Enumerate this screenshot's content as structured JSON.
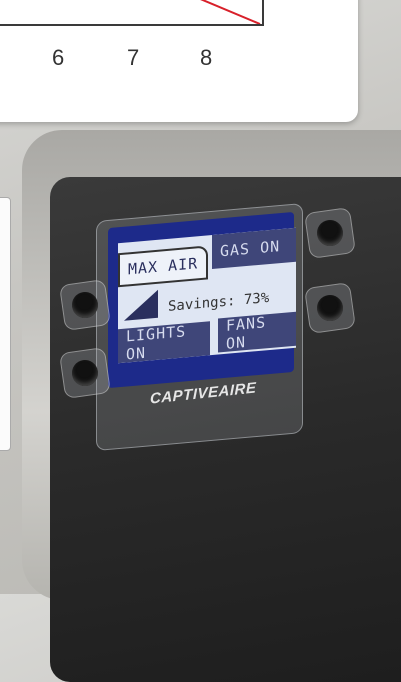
{
  "chart": {
    "ticks": [
      "6",
      "7",
      "8"
    ]
  },
  "display": {
    "brand": "CAPTIVEAIRE",
    "softkeys": {
      "max_air": "MAX AIR",
      "gas_on": "GAS ON",
      "lights_on": "LIGHTS ON",
      "fans_on": "FANS ON"
    },
    "savings": "Savings: 73%"
  },
  "colors": {
    "screen_border": "#1d2a8a",
    "softkey_bg": "#3f4679",
    "lcd_bg": "#dfe6f3"
  }
}
